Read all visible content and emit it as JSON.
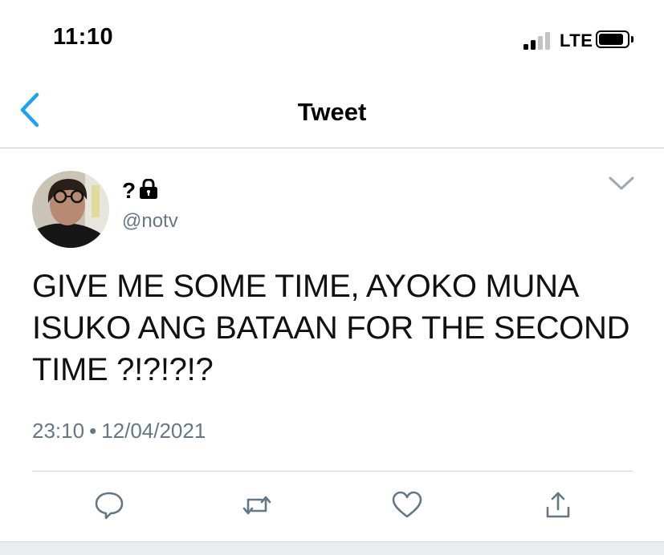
{
  "status_bar": {
    "time": "11:10",
    "network": "LTE",
    "signal_bars_filled": 2,
    "signal_bars_total": 4
  },
  "nav": {
    "title": "Tweet",
    "back_icon": "chevron-left-icon"
  },
  "tweet": {
    "display_name": "?",
    "protected_icon": "lock-icon",
    "handle": "@notv",
    "text": "GIVE ME SOME TIME, AYOKO MUNA ISUKO ANG BATAAN FOR THE SECOND TIME ?!?!?!?",
    "time": "23:10",
    "separator": "•",
    "date": "12/04/2021"
  },
  "actions": [
    "reply-icon",
    "retweet-icon",
    "like-icon",
    "share-icon"
  ],
  "colors": {
    "accent": "#1da1f2",
    "secondary_text": "#657786",
    "icon_gray": "#657786"
  }
}
